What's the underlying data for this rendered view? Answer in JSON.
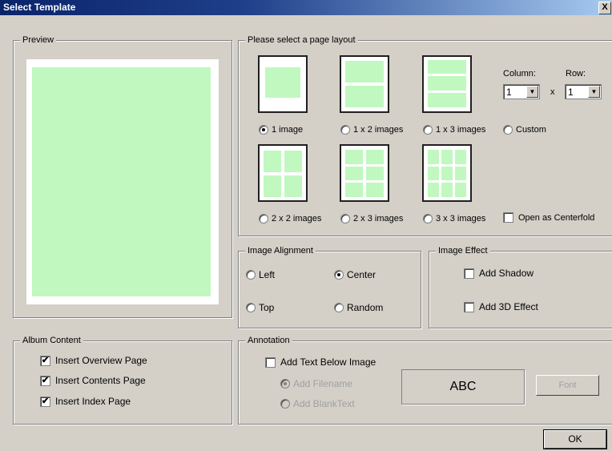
{
  "window": {
    "title": "Select Template",
    "close_label": "X"
  },
  "preview": {
    "legend": "Preview"
  },
  "layout": {
    "legend": "Please select a page layout",
    "options": [
      {
        "label": "1 image",
        "checked": true
      },
      {
        "label": "1 x 2 images",
        "checked": false
      },
      {
        "label": "1 x 3 images",
        "checked": false
      },
      {
        "label": "Custom",
        "checked": false
      },
      {
        "label": "2 x 2 images",
        "checked": false
      },
      {
        "label": "2 x 3 images",
        "checked": false
      },
      {
        "label": "3 x 3 images",
        "checked": false
      }
    ],
    "column_label": "Column:",
    "row_label": "Row:",
    "column_value": "1",
    "row_value": "1",
    "times": "x",
    "centerfold_label": "Open as Centerfold",
    "centerfold_checked": false
  },
  "alignment": {
    "legend": "Image Alignment",
    "left": "Left",
    "center": "Center",
    "top": "Top",
    "random": "Random",
    "selected": "center"
  },
  "effect": {
    "legend": "Image Effect",
    "shadow": "Add Shadow",
    "effect3d": "Add 3D Effect"
  },
  "album": {
    "legend": "Album Content",
    "overview": "Insert Overview Page",
    "contents": "Insert Contents Page",
    "index": "Insert Index Page",
    "check_mark": "✔"
  },
  "annotation": {
    "legend": "Annotation",
    "add_text": "Add Text Below Image",
    "add_filename": "Add Filename",
    "add_blank": "Add BlankText",
    "sample": "ABC",
    "font_button": "Font"
  },
  "ok_button": "OK",
  "colors": {
    "accent_green": "#c0f8c0",
    "title_bar": "#0a246a",
    "dialog_bg": "#d4d0c8"
  }
}
